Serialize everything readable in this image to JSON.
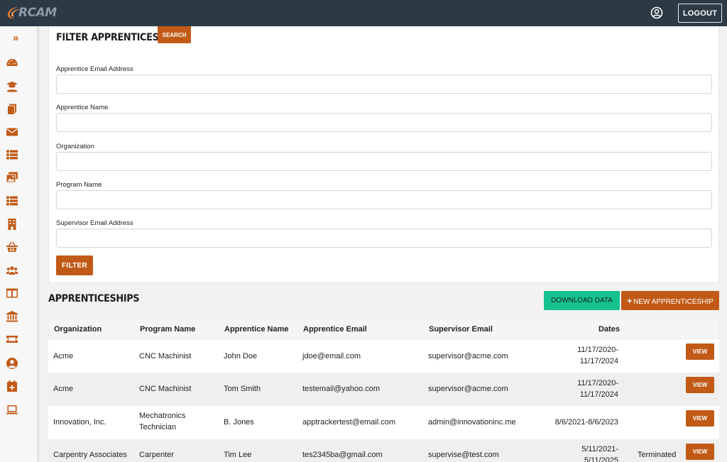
{
  "header": {
    "logo_text": "RCAM",
    "logout_label": "LOGOUT"
  },
  "sidebar": {
    "expand_glyph": "»",
    "icons": [
      "dashboard-icon",
      "graduate-icon",
      "documents-icon",
      "envelope-icon",
      "list-icon",
      "gallery-icon",
      "list-alt-icon",
      "building-icon",
      "basket-icon",
      "users-icon",
      "columns-icon",
      "bank-icon",
      "ticket-icon",
      "user-circle-icon",
      "calendar-plus-icon",
      "laptop-icon"
    ]
  },
  "filter": {
    "title": "FILTER APPRENTICESHIPS",
    "search_label": "SEARCH",
    "fields": [
      {
        "label": "Apprentice Email Address",
        "value": "",
        "placeholder": ""
      },
      {
        "label": "Apprentice Name",
        "value": "",
        "placeholder": ""
      },
      {
        "label": "Organization",
        "value": "",
        "placeholder": ""
      },
      {
        "label": "Program Name",
        "value": "",
        "placeholder": ""
      },
      {
        "label": "Supervisor Email Address",
        "value": "",
        "placeholder": ""
      }
    ],
    "filter_label": "FILTER"
  },
  "apprenticeships": {
    "title": "APPRENTICESHIPS",
    "download_label": "DOWNLOAD DATA",
    "new_label": "NEW APPRENTICESHIP",
    "columns": [
      "Organization",
      "Program Name",
      "Apprentice Name",
      "Apprentice Email",
      "Supervisor Email",
      "Dates"
    ],
    "view_label": "VIEW",
    "rows": [
      {
        "organization": "Acme",
        "program": "CNC Machinist",
        "apprentice": "John Doe",
        "email": "jdoe@email.com",
        "supervisor": "supervisor@acme.com",
        "dates": "11/17/2020-11/17/2024",
        "status": ""
      },
      {
        "organization": "Acme",
        "program": "CNC Machinist",
        "apprentice": "Tom Smith",
        "email": "testemail@yahoo.com",
        "supervisor": "supervisor@acme.com",
        "dates": "11/17/2020-11/17/2024",
        "status": ""
      },
      {
        "organization": "Innovation, Inc.",
        "program": "Mechatronics Technician",
        "apprentice": "B. Jones",
        "email": "apptrackertest@email.com",
        "supervisor": "admin@innovationinc.me",
        "dates": "8/6/2021-8/6/2023",
        "status": ""
      },
      {
        "organization": "Carpentry Associates",
        "program": "Carpenter",
        "apprentice": "Tim Lee",
        "email": "tes2345ba@gmail.com",
        "supervisor": "supervise@test.com",
        "dates": "5/11/2021-5/11/2025",
        "status": "Terminated"
      }
    ]
  },
  "colors": {
    "topbar": "#2c3a46",
    "accent": "#c25a17",
    "download": "#15c28f"
  }
}
